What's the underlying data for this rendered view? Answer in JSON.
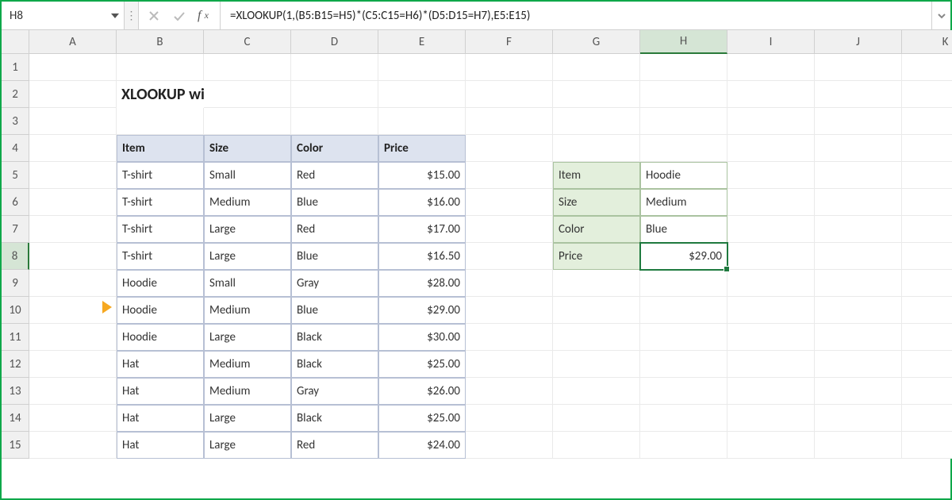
{
  "formula_bar": {
    "name_box": "H8",
    "formula": "=XLOOKUP(1,(B5:B15=H5)*(C5:C15=H6)*(D5:D15=H7),E5:E15)"
  },
  "columns": [
    "A",
    "B",
    "C",
    "D",
    "E",
    "F",
    "G",
    "H",
    "I",
    "J",
    "K"
  ],
  "rows": [
    "1",
    "2",
    "3",
    "4",
    "5",
    "6",
    "7",
    "8",
    "9",
    "10",
    "11",
    "12",
    "13",
    "14",
    "15"
  ],
  "title": "XLOOKUP with multiple criteria",
  "headers": {
    "item": "Item",
    "size": "Size",
    "color": "Color",
    "price": "Price"
  },
  "data": [
    {
      "item": "T-shirt",
      "size": "Small",
      "color": "Red",
      "price": "$15.00"
    },
    {
      "item": "T-shirt",
      "size": "Medium",
      "color": "Blue",
      "price": "$16.00"
    },
    {
      "item": "T-shirt",
      "size": "Large",
      "color": "Red",
      "price": "$17.00"
    },
    {
      "item": "T-shirt",
      "size": "Large",
      "color": "Blue",
      "price": "$16.50"
    },
    {
      "item": "Hoodie",
      "size": "Small",
      "color": "Gray",
      "price": "$28.00"
    },
    {
      "item": "Hoodie",
      "size": "Medium",
      "color": "Blue",
      "price": "$29.00"
    },
    {
      "item": "Hoodie",
      "size": "Large",
      "color": "Black",
      "price": "$30.00"
    },
    {
      "item": "Hat",
      "size": "Medium",
      "color": "Black",
      "price": "$25.00"
    },
    {
      "item": "Hat",
      "size": "Medium",
      "color": "Gray",
      "price": "$26.00"
    },
    {
      "item": "Hat",
      "size": "Large",
      "color": "Black",
      "price": "$25.00"
    },
    {
      "item": "Hat",
      "size": "Large",
      "color": "Red",
      "price": "$24.00"
    }
  ],
  "lookup": {
    "item_label": "Item",
    "item_value": "Hoodie",
    "size_label": "Size",
    "size_value": "Medium",
    "color_label": "Color",
    "color_value": "Blue",
    "price_label": "Price",
    "price_value": "$29.00"
  },
  "selected_cell": "H8",
  "highlighted_row_index": 5
}
